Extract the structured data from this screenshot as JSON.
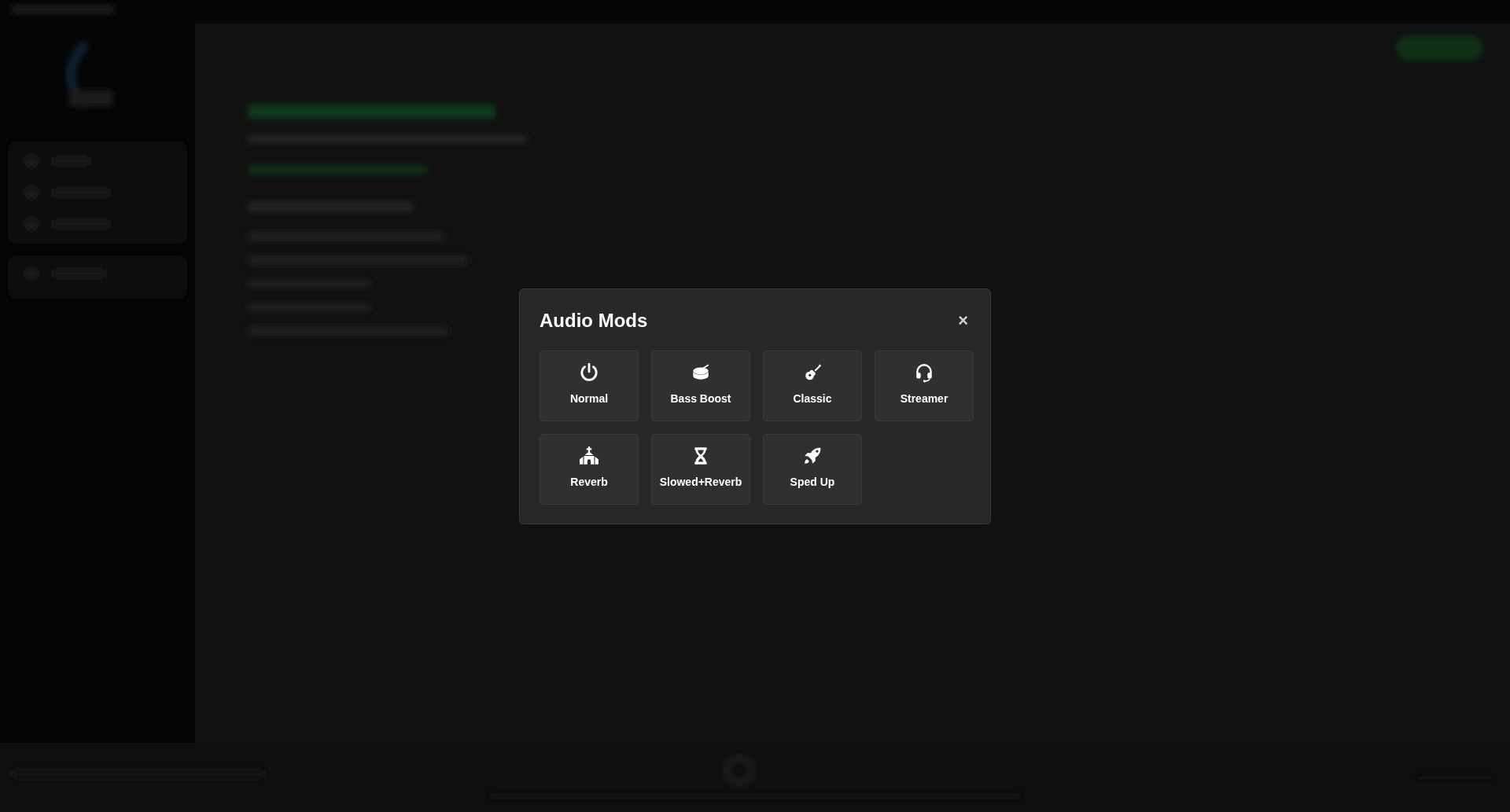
{
  "dialog": {
    "title": "Audio Mods",
    "close": "×"
  },
  "modes": [
    {
      "label": "Normal"
    },
    {
      "label": "Bass Boost"
    },
    {
      "label": "Classic"
    },
    {
      "label": "Streamer"
    },
    {
      "label": "Reverb"
    },
    {
      "label": "Slowed+Reverb"
    },
    {
      "label": "Sped Up"
    }
  ]
}
